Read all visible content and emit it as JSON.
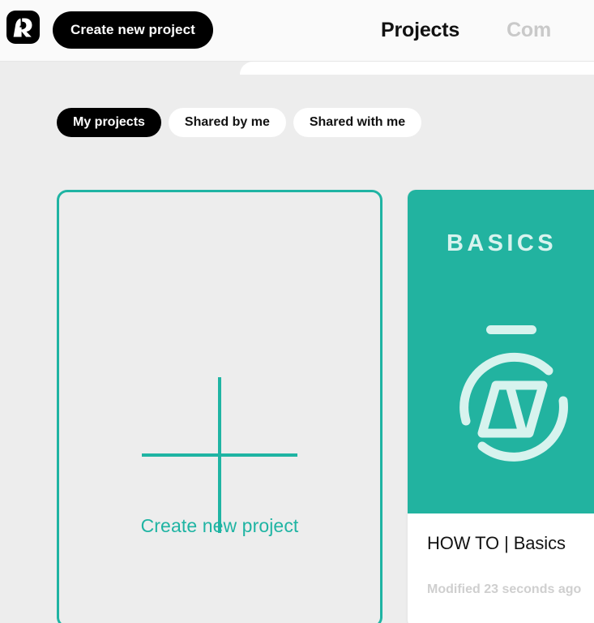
{
  "header": {
    "logo_icon": "rollapp-logo-icon",
    "create_button_label": "Create new project",
    "nav_tabs": [
      {
        "label": "Projects",
        "active": true
      },
      {
        "label": "Com",
        "active": false
      }
    ]
  },
  "filters": {
    "tabs": [
      {
        "label": "My projects",
        "active": true
      },
      {
        "label": "Shared by me",
        "active": false
      },
      {
        "label": "Shared with me",
        "active": false
      }
    ]
  },
  "projects": {
    "create_card": {
      "label": "Create new project",
      "icon": "plus-icon"
    },
    "items": [
      {
        "thumbnail_label": "BASICS",
        "thumbnail_icon": "stopwatch-logo-icon",
        "title_prefix": "HOW TO",
        "title_separator": "|",
        "title_suffix": "Basics",
        "meta": "Modified 23 seconds ago"
      }
    ]
  },
  "colors": {
    "accent_teal": "#22b3a0",
    "accent_teal_border": "#1fb4a3",
    "thumbnail_text": "#d7f3ee",
    "page_background": "#ededed",
    "header_background": "#fafafa",
    "black": "#000000",
    "muted_text": "#cfcfcf",
    "inactive_nav": "#c9c9c9"
  }
}
